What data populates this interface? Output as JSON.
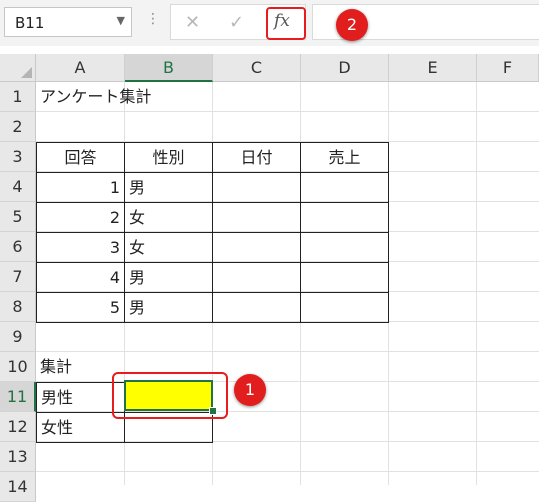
{
  "name_box": {
    "value": "B11"
  },
  "formula_bar": {
    "cancel": "✕",
    "enter": "✓",
    "fx": "fx",
    "formula": ""
  },
  "callouts": {
    "one": "1",
    "two": "2"
  },
  "columns": [
    "A",
    "B",
    "C",
    "D",
    "E",
    "F"
  ],
  "rows": [
    "1",
    "2",
    "3",
    "4",
    "5",
    "6",
    "7",
    "8",
    "9",
    "10",
    "11",
    "12",
    "13",
    "14"
  ],
  "cells": {
    "a1": "アンケート集計",
    "a3": "回答",
    "b3": "性別",
    "c3": "日付",
    "d3": "売上",
    "a4": "1",
    "b4": "男",
    "a5": "2",
    "b5": "女",
    "a6": "3",
    "b6": "女",
    "a7": "4",
    "b7": "男",
    "a8": "5",
    "b8": "男",
    "a10": "集計",
    "a11": "男性",
    "b11": "",
    "a12": "女性",
    "b12": ""
  },
  "colors": {
    "accent": "#217346",
    "highlight_fill": "#ffff00",
    "callout": "#e21d1d"
  }
}
